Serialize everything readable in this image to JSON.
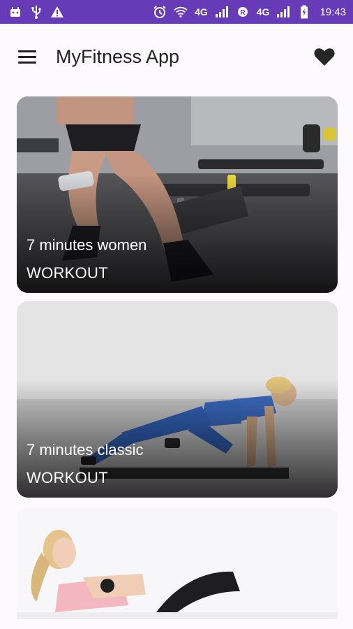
{
  "status_bar": {
    "left_icons": [
      "android-notification-icon",
      "usb-icon",
      "warning-icon"
    ],
    "network1": "4G",
    "network2": "4G",
    "time": "19:43"
  },
  "app_bar": {
    "title": "MyFitness App",
    "menu_icon": "hamburger-menu-icon",
    "favorite_icon": "heart-icon"
  },
  "workouts": [
    {
      "title": "7 minutes women",
      "subtitle": "WORKOUT"
    },
    {
      "title": "7 minutes classic",
      "subtitle": "WORKOUT"
    }
  ],
  "colors": {
    "status_bar": "#673ab7",
    "background": "#fdfafe",
    "text": "#222222",
    "card_text": "#ffffff"
  }
}
